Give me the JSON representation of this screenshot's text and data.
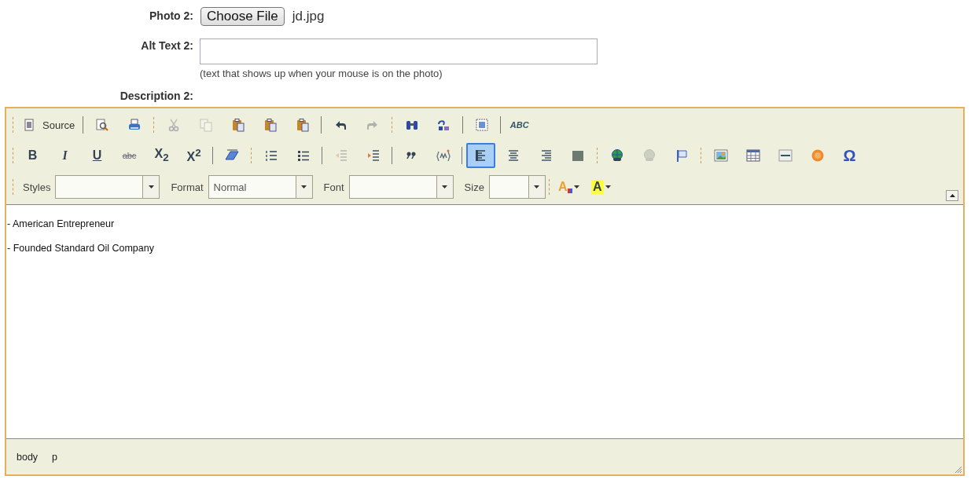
{
  "fields": [
    {
      "kind": "file",
      "label": "Photo 2:",
      "button": "Choose File",
      "value": "jd.jpg"
    },
    {
      "kind": "text",
      "label": "Alt Text 2:",
      "note": "(text that shows up when your mouse is on the photo)"
    },
    {
      "kind": "heading",
      "label": "Description 2:"
    }
  ],
  "editor": {
    "toolbar_rows": [
      [
        {
          "kind": "toolbar",
          "items": [
            {
              "kind": "button",
              "label": "Source",
              "disabled": false,
              "selected": false
            }
          ]
        },
        {
          "kind": "group",
          "items": [
            {
              "kind": "button",
              "disabled": false,
              "selected": false
            },
            {
              "kind": "button",
              "disabled": false,
              "selected": false
            }
          ]
        },
        {
          "kind": "toolbar",
          "items": [
            {
              "kind": "button",
              "disabled": true,
              "selected": false
            },
            {
              "kind": "button",
              "disabled": true,
              "selected": false
            },
            {
              "kind": "button",
              "disabled": false,
              "selected": false
            },
            {
              "kind": "button",
              "disabled": false,
              "selected": false
            },
            {
              "kind": "button",
              "disabled": false,
              "selected": false
            }
          ]
        },
        {
          "kind": "group",
          "items": [
            {
              "kind": "button",
              "disabled": false,
              "selected": false
            },
            {
              "kind": "button",
              "disabled": true,
              "selected": false
            }
          ]
        },
        {
          "kind": "toolbar",
          "items": [
            {
              "kind": "button",
              "disabled": false,
              "selected": false
            },
            {
              "kind": "button",
              "disabled": false,
              "selected": false
            }
          ]
        },
        {
          "kind": "group",
          "items": [
            {
              "kind": "button",
              "disabled": false,
              "selected": false
            }
          ]
        },
        {
          "kind": "group",
          "items": [
            {
              "kind": "button",
              "label": "ABC",
              "disabled": false,
              "selected": false
            }
          ]
        }
      ],
      [
        {
          "kind": "toolbar",
          "items": [
            {
              "kind": "button",
              "label": "B",
              "disabled": false,
              "selected": false
            },
            {
              "kind": "button",
              "label": "I",
              "disabled": false,
              "selected": false
            },
            {
              "kind": "button",
              "label": "U",
              "disabled": false,
              "selected": false
            },
            {
              "kind": "button",
              "label": "abc",
              "disabled": false,
              "selected": false
            },
            {
              "kind": "button",
              "label": "X$_{2}$",
              "disabled": false,
              "selected": false
            },
            {
              "kind": "button",
              "label": "X$^{2}$",
              "disabled": false,
              "selected": false
            }
          ]
        },
        {
          "kind": "group",
          "items": [
            {
              "kind": "button",
              "disabled": false,
              "selected": false
            }
          ]
        },
        {
          "kind": "toolbar",
          "items": [
            {
              "kind": "button",
              "disabled": false,
              "selected": false
            },
            {
              "kind": "button",
              "disabled": false,
              "selected": false
            }
          ]
        },
        {
          "kind": "group",
          "items": [
            {
              "kind": "button",
              "disabled": true,
              "selected": false
            },
            {
              "kind": "button",
              "disabled": false,
              "selected": false
            }
          ]
        },
        {
          "kind": "group",
          "items": [
            {
              "kind": "button",
              "disabled": false,
              "selected": false
            },
            {
              "kind": "button",
              "disabled": false,
              "selected": false
            }
          ]
        },
        {
          "kind": "group",
          "items": [
            {
              "kind": "button",
              "disabled": false,
              "selected": true
            },
            {
              "kind": "button",
              "disabled": false,
              "selected": false
            },
            {
              "kind": "button",
              "disabled": false,
              "selected": false
            },
            {
              "kind": "button",
              "disabled": false,
              "selected": false
            }
          ]
        },
        {
          "kind": "toolbar",
          "items": [
            {
              "kind": "button",
              "disabled": false,
              "selected": false
            },
            {
              "kind": "button",
              "disabled": true,
              "selected": false
            },
            {
              "kind": "button",
              "disabled": false,
              "selected": false
            }
          ]
        },
        {
          "kind": "toolbar",
          "items": [
            {
              "kind": "button",
              "disabled": false,
              "selected": false
            },
            {
              "kind": "button",
              "disabled": false,
              "selected": false
            },
            {
              "kind": "button",
              "disabled": false,
              "selected": false
            },
            {
              "kind": "button",
              "disabled": false,
              "selected": false
            },
            {
              "kind": "button",
              "label": "Ω",
              "disabled": false,
              "selected": false
            }
          ]
        }
      ],
      [
        {
          "kind": "toolbar",
          "items": [
            {
              "kind": "combo",
              "label": "Styles"
            },
            {
              "kind": "combo",
              "label": "Format",
              "value": "Normal"
            },
            {
              "kind": "combo",
              "label": "Font"
            },
            {
              "kind": "combo",
              "label": "Size"
            }
          ]
        },
        {
          "kind": "toolbar",
          "items": [
            {
              "kind": "button",
              "label": "A",
              "disabled": false,
              "selected": false
            },
            {
              "kind": "button",
              "label": "A",
              "disabled": false,
              "selected": false
            }
          ]
        }
      ]
    ],
    "content": [
      "- American Entrepreneur",
      "- Founded Standard Oil Company"
    ],
    "path": [
      "body",
      "p"
    ]
  }
}
